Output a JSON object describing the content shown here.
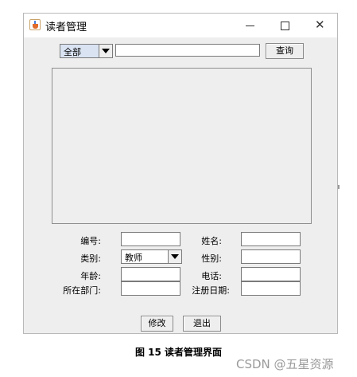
{
  "window": {
    "title": "读者管理",
    "controls": {
      "minimize": "—",
      "close": "✕"
    }
  },
  "search": {
    "category_selected": "全部",
    "keyword": "",
    "query_label": "查询"
  },
  "form": {
    "id_label": "编号:",
    "id_value": "",
    "name_label": "姓名:",
    "name_value": "",
    "type_label": "类别:",
    "type_selected": "教师",
    "gender_label": "性别:",
    "gender_value": "",
    "age_label": "年龄:",
    "age_value": "",
    "phone_label": "电话:",
    "phone_value": "",
    "dept_label": "所在部门:",
    "dept_value": "",
    "regdate_label": "注册日期:",
    "regdate_value": ""
  },
  "actions": {
    "modify_label": "修改",
    "exit_label": "退出"
  },
  "caption": "图 15 读者管理界面",
  "watermark": "CSDN @五星资源"
}
